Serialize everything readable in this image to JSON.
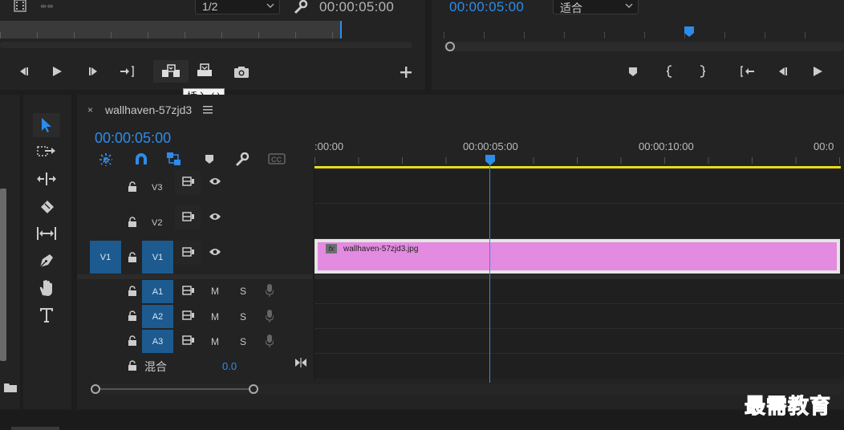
{
  "source_monitor": {
    "resolution": "1/2",
    "timecode": "00:00:05:00"
  },
  "program_monitor": {
    "timecode": "00:00:05:00",
    "fit": "适合"
  },
  "tooltip": "插入 (,)",
  "sequence": {
    "name": "wallhaven-57zjd3",
    "timecode": "00:00:05:00",
    "ruler_times": [
      ":00:00",
      "00:00:05:00",
      "00:00:10:00",
      "00:0"
    ]
  },
  "tracks": {
    "video": [
      {
        "label": "V3",
        "source": ""
      },
      {
        "label": "V2",
        "source": ""
      },
      {
        "label": "V1",
        "source": "V1"
      }
    ],
    "audio": [
      {
        "label": "A1",
        "m": "M",
        "s": "S"
      },
      {
        "label": "A2",
        "m": "M",
        "s": "S"
      },
      {
        "label": "A3",
        "m": "M",
        "s": "S"
      }
    ],
    "mix_label": "混合",
    "mix_value": "0.0"
  },
  "clip": {
    "name": "wallhaven-57zjd3.jpg",
    "fx": "fx",
    "color": "#e38ae1"
  },
  "colors": {
    "accent": "#2d8ceb",
    "playhead": "#2d8ceb",
    "work_area": "#e8dc1e",
    "target": "#1c5a8f"
  },
  "watermark": "最需教育"
}
